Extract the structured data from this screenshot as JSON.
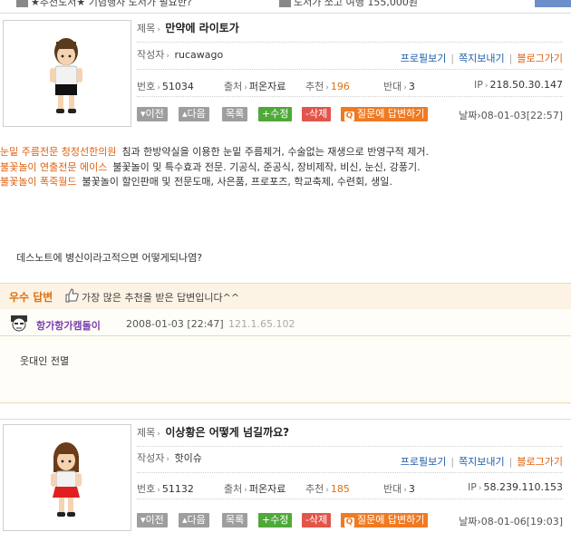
{
  "top_strip": {
    "left_text": "★추천도서★ 기념행사 도서가 필요한?",
    "right_text": "도서가 쏘고 여행 155,000원"
  },
  "post1": {
    "title_label": "제목",
    "title": "만약에 라이토가",
    "author_label": "작성자",
    "author": "rucawago",
    "profile_link": "프로필보기",
    "message_link": "쪽지보내기",
    "blog_link": "블로그가기",
    "num_label": "번호",
    "num": "51034",
    "source_label": "출처",
    "source": "퍼온자료",
    "rec_label": "추천",
    "rec": "196",
    "opp_label": "반대",
    "opp": "3",
    "ip_label": "IP",
    "ip": "218.50.30.147",
    "btn_prev": "이전",
    "btn_next": "다음",
    "btn_list": "목록",
    "btn_edit": "수정",
    "btn_delete": "삭제",
    "btn_answer": "질문에 답변하기",
    "date_label": "날짜",
    "date": "08-01-03[22:57]"
  },
  "ads": [
    {
      "name": "눈밑 주름전문 청정선한의원",
      "desc": "침과 한방약실을 이용한 눈밑 주름제거, 수술없는 재생으로 반영구적 제거."
    },
    {
      "name": "불꽃놀이 연출전문 에이스",
      "desc": "불꽃놀이 및 특수효과 전문. 기공식, 준공식, 장비제작, 비신, 눈신, 강풍기."
    },
    {
      "name": "불꽃놀이 폭죽월드",
      "desc": "불꽃놀이 할인판매 및 전문도매, 사은품, 프로포즈, 학교축제, 수련회, 생일."
    }
  ],
  "question_text": "데스노트에 병신이라고적으면 어떻게되나염?",
  "best_answer": {
    "label": "우수 답변",
    "desc": "가장 많은 추천을 받은 답변입니다^^"
  },
  "answer": {
    "name": "항가항가캠돌이",
    "date": "2008-01-03 [22:47]",
    "ip": "121.1.65.102",
    "text": "웃대인 전멸"
  },
  "post2": {
    "title_label": "제목",
    "title": "이상황은 어떻게 넘길까요?",
    "author_label": "작성자",
    "author": "핫이슈",
    "profile_link": "프로필보기",
    "message_link": "쪽지보내기",
    "blog_link": "블로그가기",
    "num_label": "번호",
    "num": "51132",
    "source_label": "출처",
    "source": "퍼온자료",
    "rec_label": "추천",
    "rec": "185",
    "opp_label": "반대",
    "opp": "3",
    "ip_label": "IP",
    "ip": "58.239.110.153",
    "btn_prev": "이전",
    "btn_next": "다음",
    "btn_list": "목록",
    "btn_edit": "수정",
    "btn_delete": "삭제",
    "btn_answer": "질문에 답변하기",
    "date_label": "날짜",
    "date": "08-01-06[19:03]"
  }
}
